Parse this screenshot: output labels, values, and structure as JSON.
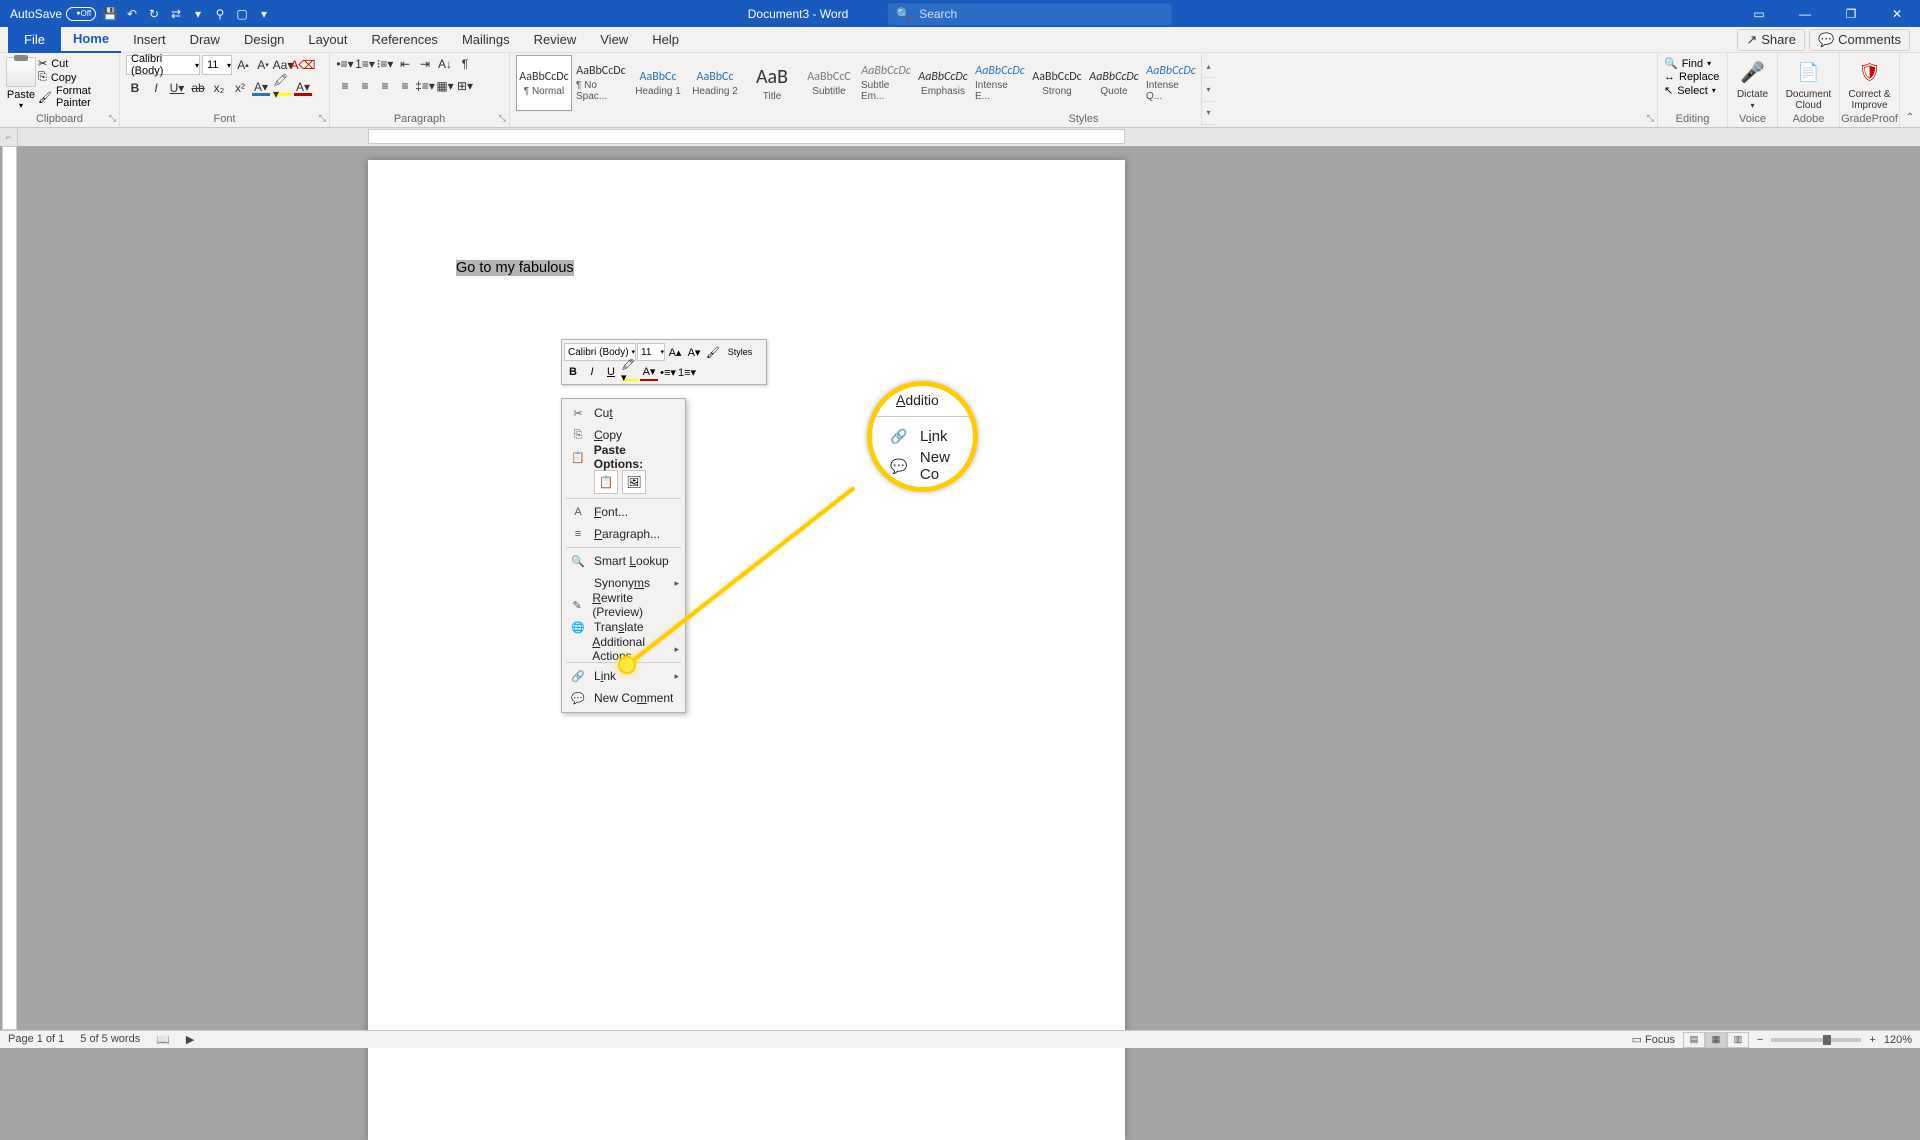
{
  "titlebar": {
    "autosave_label": "AutoSave",
    "autosave_state": "Off",
    "doc_title": "Document3 - Word",
    "search_placeholder": "Search"
  },
  "tabs": {
    "file": "File",
    "home": "Home",
    "insert": "Insert",
    "draw": "Draw",
    "design": "Design",
    "layout": "Layout",
    "references": "References",
    "mailings": "Mailings",
    "review": "Review",
    "view": "View",
    "help": "Help",
    "share": "Share",
    "comments": "Comments"
  },
  "ribbon": {
    "clipboard": {
      "label": "Clipboard",
      "paste": "Paste",
      "cut": "Cut",
      "copy": "Copy",
      "format_painter": "Format Painter"
    },
    "font": {
      "label": "Font",
      "name": "Calibri (Body)",
      "size": "11"
    },
    "paragraph": {
      "label": "Paragraph"
    },
    "styles": {
      "label": "Styles",
      "items": [
        {
          "preview": "AaBbCcDc",
          "name": "¶ Normal",
          "cls": ""
        },
        {
          "preview": "AaBbCcDc",
          "name": "¶ No Spac...",
          "cls": ""
        },
        {
          "preview": "AaBbCc",
          "name": "Heading 1",
          "cls": "blue"
        },
        {
          "preview": "AaBbCc",
          "name": "Heading 2",
          "cls": "blue"
        },
        {
          "preview": "AaB",
          "name": "Title",
          "cls": "big"
        },
        {
          "preview": "AaBbCcC",
          "name": "Subtitle",
          "cls": "gray"
        },
        {
          "preview": "AaBbCcDc",
          "name": "Subtle Em...",
          "cls": "emph gray"
        },
        {
          "preview": "AaBbCcDc",
          "name": "Emphasis",
          "cls": "emph"
        },
        {
          "preview": "AaBbCcDc",
          "name": "Intense E...",
          "cls": "emph blue"
        },
        {
          "preview": "AaBbCcDc",
          "name": "Strong",
          "cls": ""
        },
        {
          "preview": "AaBbCcDc",
          "name": "Quote",
          "cls": "emph"
        },
        {
          "preview": "AaBbCcDc",
          "name": "Intense Q...",
          "cls": "intq"
        }
      ]
    },
    "editing": {
      "label": "Editing",
      "find": "Find",
      "replace": "Replace",
      "select": "Select"
    },
    "voice": {
      "label": "Voice",
      "dictate": "Dictate"
    },
    "adobe": {
      "label": "Adobe",
      "doc_cloud": "Document Cloud"
    },
    "grade": {
      "label": "GradeProof",
      "correct": "Correct & Improve"
    }
  },
  "document": {
    "selected_text": "Go to my fabulous "
  },
  "mini_toolbar": {
    "font": "Calibri (Body)",
    "size": "11",
    "styles": "Styles"
  },
  "context_menu": {
    "cut": "Cut",
    "copy": "Copy",
    "paste_options": "Paste Options:",
    "font": "Font...",
    "paragraph": "Paragraph...",
    "smart_lookup": "Smart Lookup",
    "synonyms": "Synonyms",
    "rewrite": "Rewrite (Preview)",
    "translate": "Translate",
    "additional_actions": "Additional Actions",
    "link": "Link",
    "new_comment": "New Comment"
  },
  "callout": {
    "top": "Additio",
    "link": "Link",
    "new_comment": "New Co"
  },
  "statusbar": {
    "page": "Page 1 of 1",
    "words": "5 of 5 words",
    "focus": "Focus",
    "zoom": "120%"
  }
}
